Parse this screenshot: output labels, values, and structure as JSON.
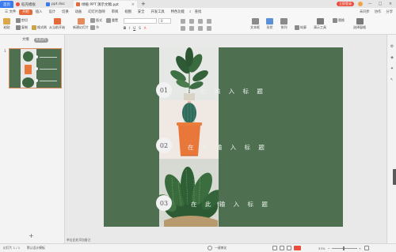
{
  "titlebar": {
    "tabs": [
      {
        "label": "首页"
      },
      {
        "label": "稻壳模板"
      },
      {
        "label": "ppt.doc"
      },
      {
        "label": "绿植 PPT 演示文稿.ppt"
      }
    ],
    "right": {
      "login_label": "立即登录",
      "avatar_label": ""
    }
  },
  "menubar": {
    "file_label": "三 文件",
    "items": [
      "开始",
      "插入",
      "设计",
      "切换",
      "动画",
      "幻灯片放映",
      "审阅",
      "视图",
      "安全",
      "开发工具",
      "特色功能",
      "查找"
    ],
    "right": [
      "未同步",
      "协作",
      "分享"
    ]
  },
  "ribbon": {
    "paste": "粘贴",
    "cut": "剪切",
    "copy": "复制",
    "format_painter": "格式刷",
    "from_current": "从当前开始",
    "new_slide": "新建幻灯片",
    "layout": "版式",
    "section": "节",
    "reset": "重置",
    "font_size": "0",
    "text_box": "文本框",
    "shape": "形状",
    "arrange": "排列",
    "outline": "轮廓",
    "presentation_tools": "演示工具",
    "replace": "替换",
    "select_pane": "选择窗格"
  },
  "left_panel": {
    "tabs": [
      "大纲",
      "幻灯片"
    ],
    "slide_number": "1"
  },
  "slide": {
    "items": [
      {
        "num": "01",
        "title": "在 此 输 入 标 题"
      },
      {
        "num": "02",
        "title": "在 此 输 入 标 题"
      },
      {
        "num": "03",
        "title": "在 此 输 入 标 题"
      }
    ]
  },
  "notes": {
    "placeholder": "单击此处添加备注"
  },
  "statusbar": {
    "slide_info": "幻灯片 1 / 1",
    "theme": "默认设计模板",
    "beautify": "一键美化",
    "zoom": "53%"
  },
  "colors": {
    "slide_bg": "#4e7051",
    "accent": "#e56a3a",
    "home_tab": "#3a7bf0"
  }
}
